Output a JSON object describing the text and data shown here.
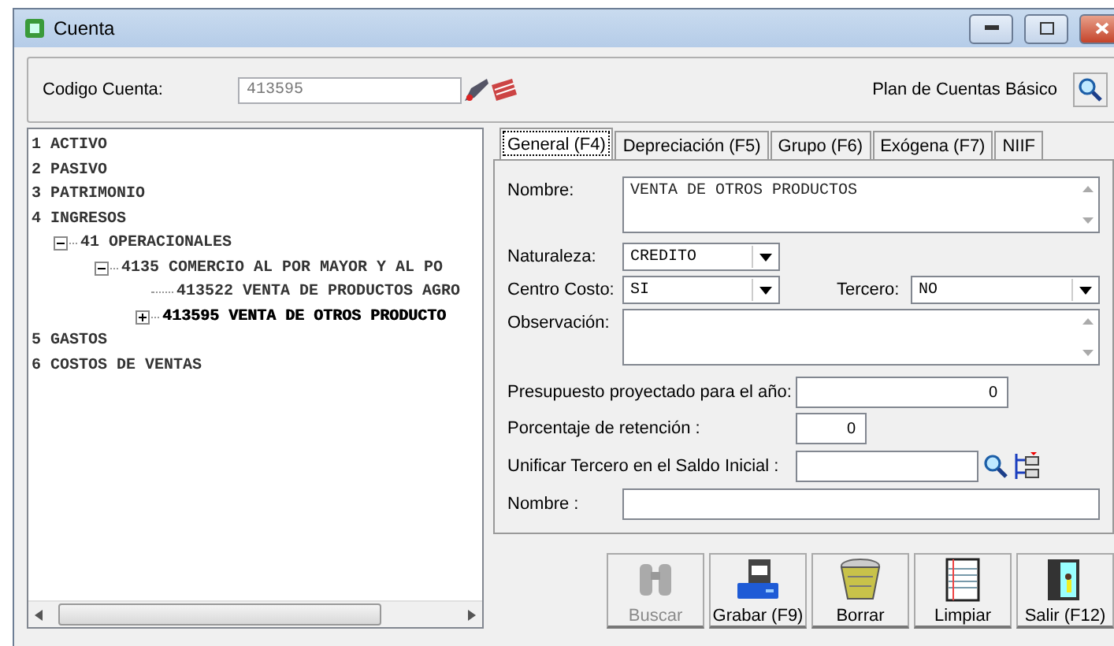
{
  "window": {
    "title": "Cuenta"
  },
  "header": {
    "code_label": "Codigo Cuenta:",
    "code_value": "413595",
    "plan_label": "Plan de Cuentas Básico"
  },
  "tree": [
    {
      "label": "1 ACTIVO",
      "selected": false
    },
    {
      "label": "2 PASIVO",
      "selected": false
    },
    {
      "label": "3 PATRIMONIO",
      "selected": false
    },
    {
      "label": "4 INGRESOS",
      "selected": false,
      "children": [
        {
          "label": "41 OPERACIONALES",
          "selected": false,
          "expanded": true,
          "children": [
            {
              "label": "4135 COMERCIO AL POR MAYOR Y AL PO",
              "selected": false,
              "expanded": true,
              "children": [
                {
                  "label": "413522 VENTA DE PRODUCTOS AGRO",
                  "selected": false
                },
                {
                  "label": "413595 VENTA DE OTROS PRODUCTO",
                  "selected": true,
                  "expanded": false
                }
              ]
            }
          ]
        }
      ]
    },
    {
      "label": "5 GASTOS",
      "selected": false
    },
    {
      "label": "6 COSTOS DE VENTAS",
      "selected": false
    }
  ],
  "tabs": [
    {
      "label": "General (F4)",
      "selected": true
    },
    {
      "label": "Depreciación (F5)",
      "selected": false
    },
    {
      "label": "Grupo (F6)",
      "selected": false
    },
    {
      "label": "Exógena (F7)",
      "selected": false
    },
    {
      "label": "NIIF",
      "selected": false
    }
  ],
  "form": {
    "nombre_label": "Nombre:",
    "nombre_value": "VENTA DE OTROS PRODUCTOS",
    "naturaleza_label": "Naturaleza:",
    "naturaleza_value": "CREDITO",
    "centro_label": "Centro Costo:",
    "centro_value": "SI",
    "tercero_label": "Tercero:",
    "tercero_value": "NO",
    "observacion_label": "Observación:",
    "presupuesto_label": "Presupuesto proyectado para el año:",
    "presupuesto_value": "0",
    "retencion_label": "Porcentaje de retención :",
    "retencion_value": "0",
    "unificar_label": "Unificar Tercero en el Saldo Inicial :",
    "nombre2_label": "Nombre :"
  },
  "buttons": [
    {
      "kind": "binoculars",
      "label": "Buscar",
      "disabled": true
    },
    {
      "kind": "save",
      "label": "Grabar (F9)",
      "disabled": false
    },
    {
      "kind": "basket",
      "label": "Borrar",
      "disabled": false
    },
    {
      "kind": "notebook",
      "label": "Limpiar",
      "disabled": false
    },
    {
      "kind": "exit",
      "label": "Salir (F12)",
      "disabled": false
    }
  ]
}
